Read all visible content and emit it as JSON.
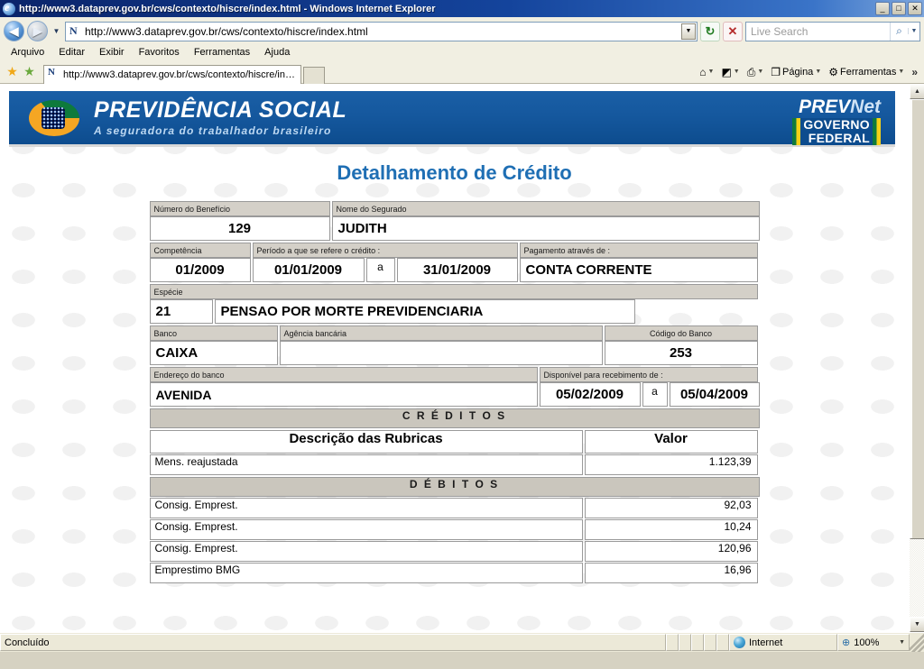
{
  "window": {
    "title": "http://www3.dataprev.gov.br/cws/contexto/hiscre/index.html - Windows Internet Explorer",
    "minimize_label": "_",
    "maximize_label": "□",
    "close_label": "✕"
  },
  "nav": {
    "back_label": "◀",
    "forward_label": "▶",
    "history_caret": "▼",
    "url": "http://www3.dataprev.gov.br/cws/contexto/hiscre/index.html",
    "url_caret": "▼",
    "refresh_label": "↻",
    "stop_label": "✕"
  },
  "search": {
    "placeholder": "Live Search",
    "go_label": "⌕",
    "caret": "▼"
  },
  "menu": {
    "items": [
      {
        "label": "Arquivo"
      },
      {
        "label": "Editar"
      },
      {
        "label": "Exibir"
      },
      {
        "label": "Favoritos"
      },
      {
        "label": "Ferramentas"
      },
      {
        "label": "Ajuda"
      }
    ]
  },
  "favbar": {
    "favorites_star": "★",
    "add_star": "★"
  },
  "tabs": [
    {
      "label": "http://www3.dataprev.gov.br/cws/contexto/hiscre/in…"
    }
  ],
  "commandbar": {
    "home": {
      "glyph": "⌂",
      "caret": "▼"
    },
    "feeds": {
      "glyph": "◩",
      "caret": "▼"
    },
    "print": {
      "glyph": "⎙",
      "caret": "▼"
    },
    "page": {
      "glyph": "❐",
      "label": "Página",
      "caret": "▼"
    },
    "tools": {
      "glyph": "⚙",
      "label": "Ferramentas",
      "caret": "▼"
    },
    "overflow": "»"
  },
  "banner": {
    "brand_line1": "PREVIDÊNCIA SOCIAL",
    "brand_line2": "A seguradora do trabalhador brasileiro",
    "prevnet_prev": "PREV",
    "prevnet_net": "Net",
    "gov_line1": "GOVERNO",
    "gov_line2": "FEDERAL"
  },
  "page": {
    "title": "Detalhamento de Crédito",
    "fields": {
      "beneficio_label": "Número do Benefício",
      "beneficio_value": "129",
      "segurado_label": "Nome do Segurado",
      "segurado_value": "JUDITH",
      "competencia_label": "Competência",
      "competencia_value": "01/2009",
      "periodo_label": "Período a que se refere o crédito :",
      "periodo_de": "01/01/2009",
      "periodo_sep": "a",
      "periodo_ate": "31/01/2009",
      "pagamento_label": "Pagamento através de :",
      "pagamento_value": "CONTA CORRENTE",
      "especie_label": "Espécie",
      "especie_codigo": "21",
      "especie_descricao": "PENSAO POR MORTE PREVIDENCIARIA",
      "banco_label": "Banco",
      "banco_value": "CAIXA",
      "agencia_label": "Agência bancária",
      "agencia_value": "",
      "codigo_banco_label": "Código do Banco",
      "codigo_banco_value": "253",
      "endereco_label": "Endereço do banco",
      "endereco_value": "AVENIDA",
      "disponivel_label": "Disponível para recebimento de :",
      "disponivel_de": "05/02/2009",
      "disponivel_sep": "a",
      "disponivel_ate": "05/04/2009"
    },
    "creditos": {
      "band": "C R É D I T O S",
      "col_descricao": "Descrição das Rubricas",
      "col_valor": "Valor",
      "rows": [
        {
          "descricao": "Mens. reajustada",
          "valor": "1.123,39"
        }
      ]
    },
    "debitos": {
      "band": "D É B I T O S",
      "rows": [
        {
          "descricao": "Consig. Emprest.",
          "valor": "92,03"
        },
        {
          "descricao": "Consig. Emprest.",
          "valor": "10,24"
        },
        {
          "descricao": "Consig. Emprest.",
          "valor": "120,96"
        },
        {
          "descricao": "Emprestimo BMG",
          "valor": "16,96"
        }
      ]
    }
  },
  "scrollbar": {
    "up_label": "▲",
    "down_label": "▼"
  },
  "statusbar": {
    "status": "Concluído",
    "zone": "Internet",
    "zoom": "100%",
    "zoom_caret": "▼",
    "zoom_glyph": "⊕"
  }
}
